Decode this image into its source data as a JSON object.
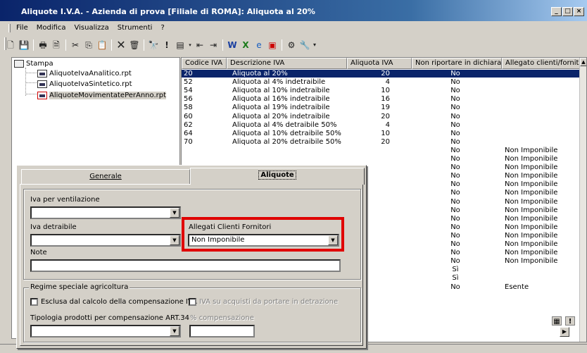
{
  "window": {
    "title": "Aliquote I.V.A. - Azienda di prova [Filiale di ROMA]: Aliquota al 20%",
    "btn_min": "_",
    "btn_max": "□",
    "btn_close": "×"
  },
  "menu": [
    "File",
    "Modifica",
    "Visualizza",
    "Strumenti",
    "?"
  ],
  "toolbar_icons": [
    "new-icon",
    "save-icon",
    "print-icon",
    "print-preview-icon",
    "cut-icon",
    "copy-icon",
    "paste-icon",
    "delete-icon",
    "clear-icon",
    "find-icon",
    "alert-icon",
    "form-icon",
    "first-record-icon",
    "last-record-icon",
    "word-icon",
    "excel-icon",
    "web-icon",
    "pdf-icon",
    "wizard-icon",
    "tools-icon",
    "more-icon"
  ],
  "tree": {
    "root": "Stampa",
    "items": [
      "AliquoteIvaAnalitico.rpt",
      "AliquoteIvaSintetico.rpt",
      "AliquoteMovimentatePerAnno.rpt"
    ]
  },
  "grid": {
    "columns": [
      "Codice IVA",
      "Descrizione IVA",
      "Aliquota IVA",
      "Non riportare in dichiara...",
      "Allegato clienti/fornitori"
    ],
    "rows": [
      {
        "code": "20",
        "desc": "Aliquota al 20%",
        "rate": "20",
        "nonrip": "No",
        "alleg": ""
      },
      {
        "code": "52",
        "desc": "Aliquota al 4% indetraibile",
        "rate": "4",
        "nonrip": "No",
        "alleg": ""
      },
      {
        "code": "54",
        "desc": "Aliquota al 10% indetraibile",
        "rate": "10",
        "nonrip": "No",
        "alleg": ""
      },
      {
        "code": "56",
        "desc": "Aliquota al 16% indetraibile",
        "rate": "16",
        "nonrip": "No",
        "alleg": ""
      },
      {
        "code": "58",
        "desc": "Aliquota al 19% indetraibile",
        "rate": "19",
        "nonrip": "No",
        "alleg": ""
      },
      {
        "code": "60",
        "desc": "Aliquota al 20% indetraibile",
        "rate": "20",
        "nonrip": "No",
        "alleg": ""
      },
      {
        "code": "62",
        "desc": "Aliquota al 4% detraibile 50%",
        "rate": "4",
        "nonrip": "No",
        "alleg": ""
      },
      {
        "code": "64",
        "desc": "Aliquota al 10% detraibile 50%",
        "rate": "10",
        "nonrip": "No",
        "alleg": ""
      },
      {
        "code": "70",
        "desc": "Aliquota al 20% detraibile 50%",
        "rate": "20",
        "nonrip": "No",
        "alleg": ""
      },
      {
        "code": "",
        "desc": "",
        "rate": "",
        "nonrip": "No",
        "alleg": "Non Imponibile"
      },
      {
        "code": "",
        "desc": "",
        "rate": "",
        "nonrip": "No",
        "alleg": "Non Imponibile"
      },
      {
        "code": "",
        "desc": "",
        "rate": "",
        "nonrip": "No",
        "alleg": "Non Imponibile"
      },
      {
        "code": "",
        "desc": "",
        "rate": "",
        "nonrip": "No",
        "alleg": "Non Imponibile"
      },
      {
        "code": "",
        "desc": "",
        "rate": "",
        "nonrip": "No",
        "alleg": "Non Imponibile"
      },
      {
        "code": "",
        "desc": "",
        "rate": "",
        "nonrip": "No",
        "alleg": "Non Imponibile"
      },
      {
        "code": "",
        "desc": "",
        "rate": "",
        "nonrip": "No",
        "alleg": "Non Imponibile"
      },
      {
        "code": "",
        "desc": "",
        "rate": "",
        "nonrip": "No",
        "alleg": "Non Imponibile"
      },
      {
        "code": "",
        "desc": "",
        "rate": "",
        "nonrip": "No",
        "alleg": "Non Imponibile"
      },
      {
        "code": "",
        "desc": "",
        "rate": "",
        "nonrip": "No",
        "alleg": "Non Imponibile"
      },
      {
        "code": "",
        "desc": "",
        "rate": "",
        "nonrip": "No",
        "alleg": "Non Imponibile"
      },
      {
        "code": "",
        "desc": "",
        "rate": "",
        "nonrip": "No",
        "alleg": "Non Imponibile"
      },
      {
        "code": "",
        "desc": "",
        "rate": "",
        "nonrip": "No",
        "alleg": "Non Imponibile"
      },
      {
        "code": "",
        "desc": "",
        "rate": "",
        "nonrip": "No",
        "alleg": "Non Imponibile"
      },
      {
        "code": "",
        "desc": "",
        "rate": "",
        "nonrip": "Sì",
        "alleg": ""
      },
      {
        "code": "",
        "desc": "",
        "rate": "",
        "nonrip": "Sì",
        "alleg": ""
      },
      {
        "code": "",
        "desc": "",
        "rate": "",
        "nonrip": "No",
        "alleg": "Esente"
      }
    ]
  },
  "dialog": {
    "tabs": {
      "generale": "Generale",
      "aliquote": "Aliquote"
    },
    "iva_ventilazione_label": "Iva  per ventilazione",
    "iva_ventilazione_value": "",
    "iva_detraibile_label": "Iva detraibile",
    "iva_detraibile_value": "",
    "allegati_label": "Allegati Clienti Fornitori",
    "allegati_value": "Non Imponibile",
    "note_label": "Note",
    "note_value": "",
    "regime_group": "Regime speciale agricoltura",
    "esclusa_label": "Esclusa dal calcolo della compensazione IVA",
    "iva_acquisti_label": "IVA su acquisti da portare in detrazione",
    "tipologia_label": "Tipologia prodotti per compensazione ART.34",
    "tipologia_value": "",
    "perc_comp_label": "% compensazione",
    "perc_comp_value": ""
  },
  "colors": {
    "selection": "#0a246a",
    "highlight_border": "#e00000",
    "title_start": "#0a246a",
    "title_end": "#a6caf0"
  }
}
